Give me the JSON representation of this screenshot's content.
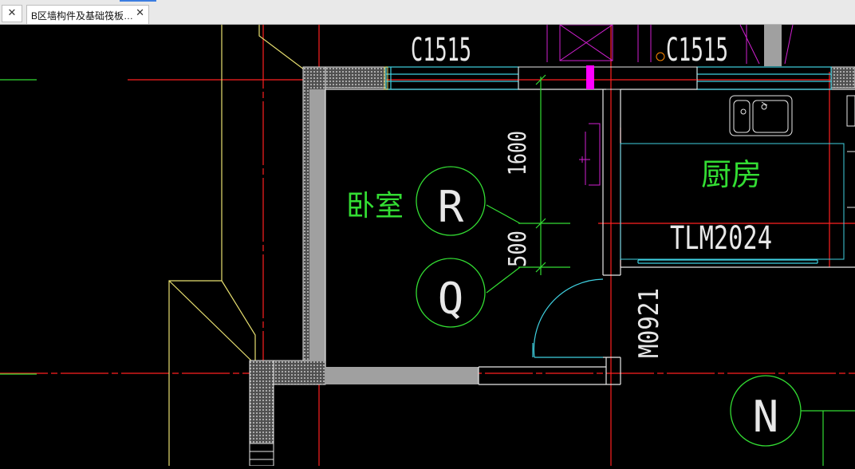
{
  "tabs": {
    "closed_tab_close": "✕",
    "active_label": "B区墙构件及基础筏板…",
    "active_close": "✕"
  },
  "drawing": {
    "window_label_left": "C1515",
    "window_label_right": "C1515",
    "dimension_upper": "1600",
    "dimension_lower": "500",
    "room_bedroom": "卧室",
    "room_kitchen": "厨房",
    "sliding_door_label": "TLM2024",
    "door_label": "M0921",
    "tag_r": "R",
    "tag_q": "Q",
    "tag_n": "N"
  },
  "colors": {
    "background": "#000000",
    "axis_red": "#ff2020",
    "wall_white": "#e8e8e8",
    "window_cyan": "#3fd0e0",
    "text_green": "#33dd33",
    "marker_magenta": "#ff00ff",
    "outline_yellow": "#e8e070",
    "wall_fill_gray": "#a0a0a0"
  }
}
